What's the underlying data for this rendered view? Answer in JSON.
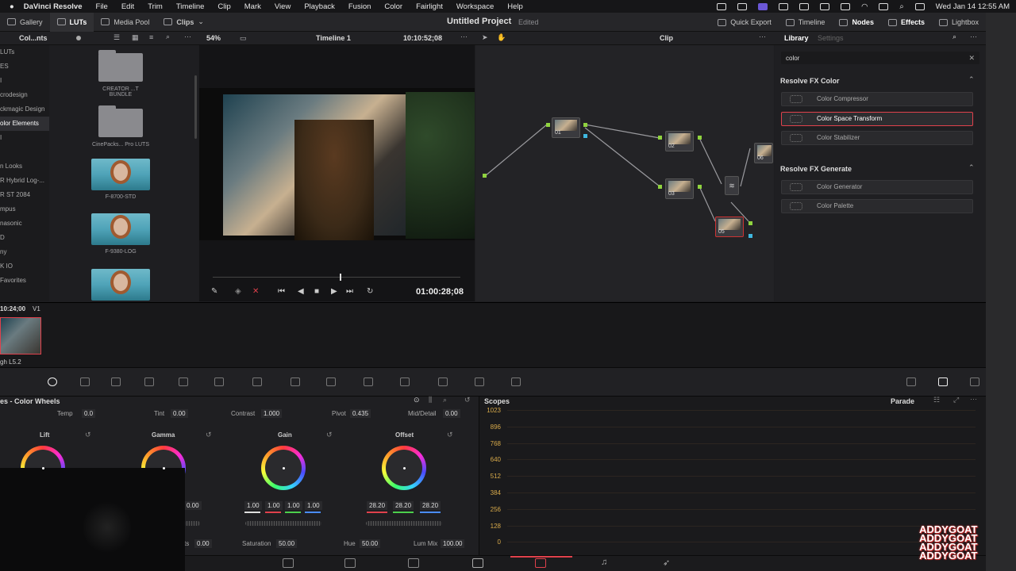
{
  "menubar": {
    "app": "DaVinci Resolve",
    "items": [
      "File",
      "Edit",
      "Trim",
      "Timeline",
      "Clip",
      "Mark",
      "View",
      "Playback",
      "Fusion",
      "Color",
      "Fairlight",
      "Workspace",
      "Help"
    ],
    "datetime": "Wed Jan 14  12:55 AM"
  },
  "toolbar": {
    "gallery": "Gallery",
    "luts": "LUTs",
    "media_pool": "Media Pool",
    "clips": "Clips",
    "project_title": "Untitled Project",
    "edited": "Edited",
    "quick_export": "Quick Export",
    "timeline": "Timeline",
    "nodes": "Nodes",
    "effects": "Effects",
    "lightbox": "Lightbox"
  },
  "subbar": {
    "lut_panel": "Col...nts",
    "zoom": "54%",
    "timeline_name": "Timeline 1",
    "timecode": "10:10:52;08",
    "node_mode": "Clip",
    "library_tab": "Library",
    "settings_tab": "Settings"
  },
  "lut_sidebar": [
    "LUTs",
    "ES",
    "I",
    "crodesign",
    "ckmagic Design",
    "olor Elements",
    "I",
    "",
    "n Looks",
    "R Hybrid Log-...",
    "R ST 2084",
    "mpus",
    "nasonic",
    "D",
    "ny",
    "K IO",
    "Favorites"
  ],
  "lut_sidebar_selected": 5,
  "thumbnails": [
    {
      "label": "CREATOR ...T BUNDLE",
      "kind": "folder"
    },
    {
      "label": "CinePacks... Pro LUTS",
      "kind": "folder"
    },
    {
      "label": "F-8700-STD",
      "kind": "image"
    },
    {
      "label": "F-9380-LOG",
      "kind": "image"
    },
    {
      "label": "",
      "kind": "image"
    }
  ],
  "viewer": {
    "timecode": "01:00:28;08"
  },
  "nodes": [
    {
      "id": "01"
    },
    {
      "id": "02"
    },
    {
      "id": "03"
    },
    {
      "id": "05"
    },
    {
      "id": "06"
    }
  ],
  "library": {
    "search_value": "color",
    "sections": [
      {
        "title": "Resolve FX Color",
        "items": [
          "Color Compressor",
          "Color Space Transform",
          "Color Stabilizer"
        ]
      },
      {
        "title": "Resolve FX Generate",
        "items": [
          "Color Generator",
          "Color Palette"
        ]
      }
    ],
    "highlighted": "Color Space Transform"
  },
  "timeline": {
    "timecode": "10:24;00",
    "track": "V1",
    "clip_label": "gh L5.2"
  },
  "color_wheels": {
    "title": "es - Color Wheels",
    "temp_label": "Temp",
    "temp": "0.0",
    "tint_label": "Tint",
    "tint": "0.00",
    "contrast_label": "Contrast",
    "contrast": "1.000",
    "pivot_label": "Pivot",
    "pivot": "0.435",
    "middetail_label": "Mid/Detail",
    "middetail": "0.00",
    "wheels": [
      {
        "name": "Lift",
        "values": []
      },
      {
        "name": "Gamma",
        "values": [
          "0.00"
        ]
      },
      {
        "name": "Gain",
        "values": [
          "1.00",
          "1.00",
          "1.00",
          "1.00"
        ]
      },
      {
        "name": "Offset",
        "values": [
          "28.20",
          "28.20",
          "28.20"
        ]
      }
    ],
    "bottom": {
      "first_label": "ts",
      "first": "0.00",
      "saturation_label": "Saturation",
      "saturation": "50.00",
      "hue_label": "Hue",
      "hue": "50.00",
      "lummix_label": "Lum Mix",
      "lummix": "100.00"
    }
  },
  "scopes": {
    "title": "Scopes",
    "mode": "Parade",
    "ticks": [
      "1023",
      "896",
      "768",
      "640",
      "512",
      "384",
      "256",
      "128",
      "0"
    ]
  },
  "watermark": [
    "ADDYGOAT",
    "ADDYGOAT",
    "ADDYGOAT",
    "ADDYGOAT"
  ]
}
